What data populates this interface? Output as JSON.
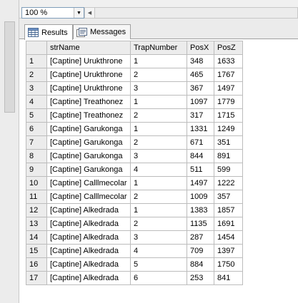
{
  "zoom": {
    "value": "100 %"
  },
  "tabs": [
    {
      "label": "Results",
      "icon": "grid-icon"
    },
    {
      "label": "Messages",
      "icon": "messages-icon"
    }
  ],
  "columns": [
    "strName",
    "TrapNumber",
    "PosX",
    "PosZ"
  ],
  "rows": [
    {
      "n": "1",
      "name": "[Captine] Urukthrone",
      "trap": "1",
      "x": "348",
      "z": "1633"
    },
    {
      "n": "2",
      "name": "[Captine] Urukthrone",
      "trap": "2",
      "x": "465",
      "z": "1767"
    },
    {
      "n": "3",
      "name": "[Captine] Urukthrone",
      "trap": "3",
      "x": "367",
      "z": "1497"
    },
    {
      "n": "4",
      "name": "[Captine] Treathonez",
      "trap": "1",
      "x": "1097",
      "z": "1779"
    },
    {
      "n": "5",
      "name": "[Captine] Treathonez",
      "trap": "2",
      "x": "317",
      "z": "1715"
    },
    {
      "n": "6",
      "name": "[Captine] Garukonga",
      "trap": "1",
      "x": "1331",
      "z": "1249"
    },
    {
      "n": "7",
      "name": "[Captine] Garukonga",
      "trap": "2",
      "x": "671",
      "z": "351"
    },
    {
      "n": "8",
      "name": "[Captine] Garukonga",
      "trap": "3",
      "x": "844",
      "z": "891"
    },
    {
      "n": "9",
      "name": "[Captine] Garukonga",
      "trap": "4",
      "x": "511",
      "z": "599"
    },
    {
      "n": "10",
      "name": "[Captine] Calllmecolar",
      "trap": "1",
      "x": "1497",
      "z": "1222"
    },
    {
      "n": "11",
      "name": "[Captine] Calllmecolar",
      "trap": "2",
      "x": "1009",
      "z": "357"
    },
    {
      "n": "12",
      "name": "[Captine] Alkedrada",
      "trap": "1",
      "x": "1383",
      "z": "1857"
    },
    {
      "n": "13",
      "name": "[Captine] Alkedrada",
      "trap": "2",
      "x": "1135",
      "z": "1691"
    },
    {
      "n": "14",
      "name": "[Captine] Alkedrada",
      "trap": "3",
      "x": "287",
      "z": "1454"
    },
    {
      "n": "15",
      "name": "[Captine] Alkedrada",
      "trap": "4",
      "x": "709",
      "z": "1397"
    },
    {
      "n": "16",
      "name": "[Captine] Alkedrada",
      "trap": "5",
      "x": "884",
      "z": "1750"
    },
    {
      "n": "17",
      "name": "[Captine] Alkedrada",
      "trap": "6",
      "x": "253",
      "z": "841"
    }
  ]
}
